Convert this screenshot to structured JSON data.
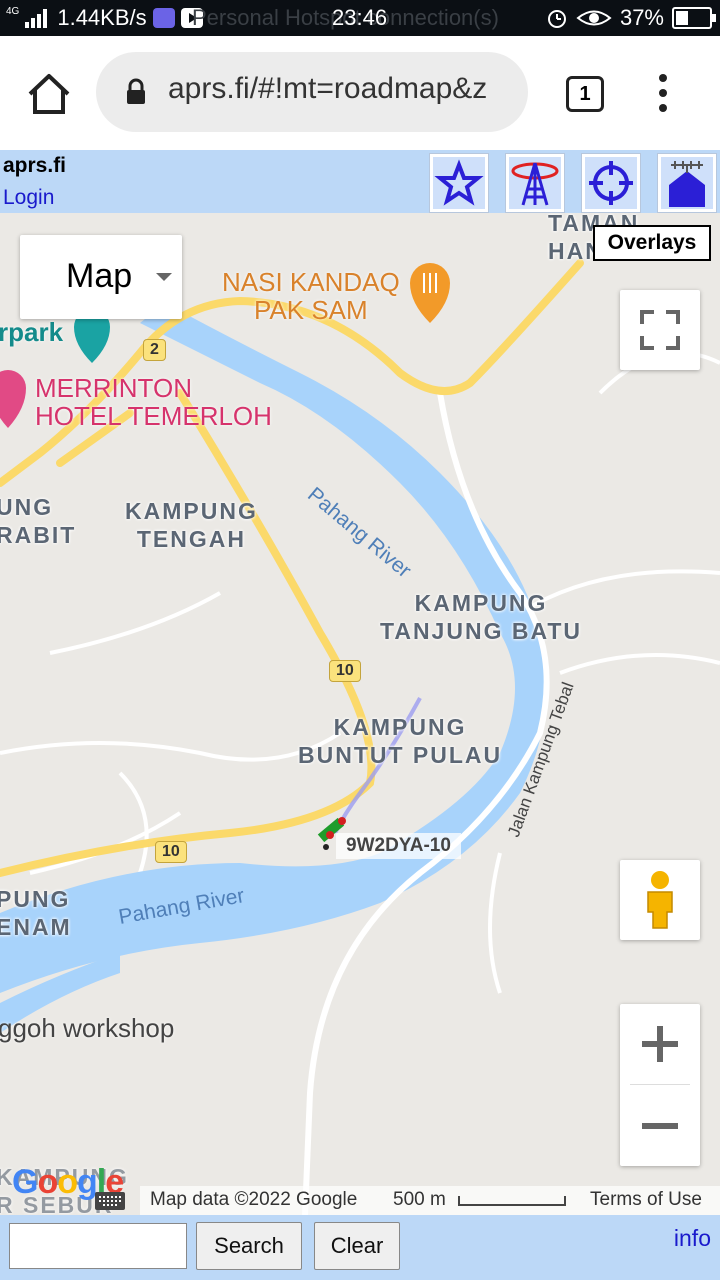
{
  "status_bar": {
    "network_type": "4G",
    "speed": "1.44KB/s",
    "hotspot_text": "Personal Hotspot connection(s)",
    "time": "23:46",
    "battery": "37%",
    "battery_level": 0.37
  },
  "browser": {
    "url": "aprs.fi/#!mt=roadmap&z",
    "tab_count": "1"
  },
  "site": {
    "brand": "aprs.fi",
    "login": "Login"
  },
  "map": {
    "map_type": "Map",
    "overlays": "Overlays",
    "callsign": "9W2DYA-10",
    "places": {
      "taman_han": "TAMAN\nHAN",
      "kampung_tengah": "KAMPUNG\nTENGAH",
      "kampung_rabit": "UNG\nRABIT",
      "kampung_tanjung_batu": "KAMPUNG\nTANJUNG BATU",
      "kampung_buntut_pulau": "KAMPUNG\nBUNTUT PULAU",
      "kampung_enam": "PUNG\nENAM",
      "kampung_sebur": "KAMPUNG\nR SEBUR"
    },
    "pois": {
      "nasi_kandaq": "NASI KANDAQ\nPAK SAM",
      "merrinton": "MERRINTON\nHOTEL TEMERLOH",
      "park": "rpark",
      "workshop": "ggoh workshop"
    },
    "rivers": [
      "Pahang River",
      "Pahang River"
    ],
    "road_name": "Jalan Kampung Tebal",
    "route_shields": [
      "2",
      "10",
      "10"
    ],
    "footer": {
      "logo": "Google",
      "map_data": "Map data ©2022 Google",
      "scale": "500 m",
      "terms": "Terms of Use"
    }
  },
  "bottom": {
    "search_value": "",
    "search_label": "Search",
    "clear_label": "Clear",
    "info_label": "info"
  },
  "colors": {
    "header_bg": "#bcd8f7",
    "water": "#a8d3fb",
    "road_major": "#fbd96a",
    "land": "#ebe9e5"
  }
}
